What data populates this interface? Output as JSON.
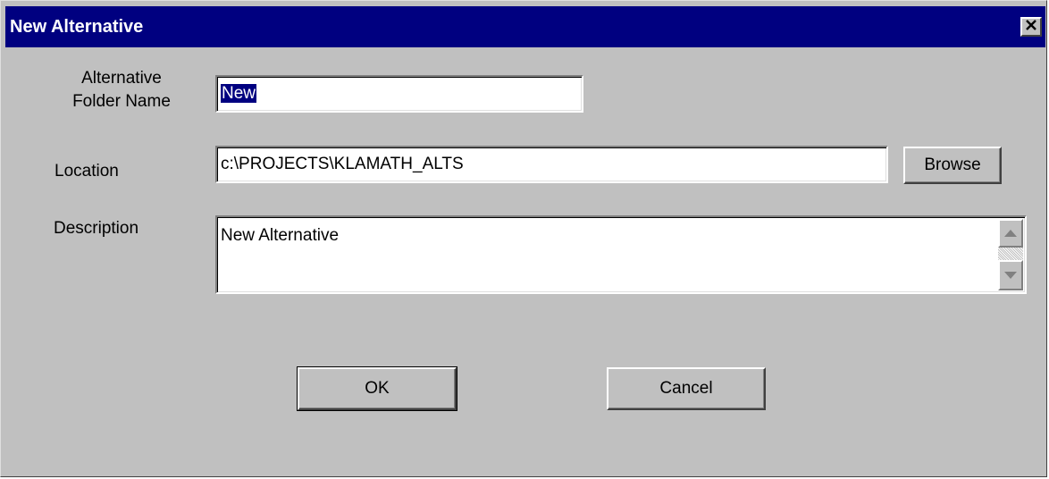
{
  "dialog": {
    "title": "New Alternative",
    "close_symbol": "✕"
  },
  "fields": {
    "folder_name_label_line1": "Alternative",
    "folder_name_label_line2": "Folder Name",
    "folder_name_value": "New",
    "location_label": "Location",
    "location_value": "c:\\PROJECTS\\KLAMATH_ALTS",
    "description_label": "Description",
    "description_value": "New Alternative"
  },
  "buttons": {
    "browse_label": "Browse",
    "ok_label": "OK",
    "cancel_label": "Cancel"
  },
  "colors": {
    "titlebar": "#000080",
    "window_face": "#c0c0c0",
    "selection": "#000080"
  }
}
